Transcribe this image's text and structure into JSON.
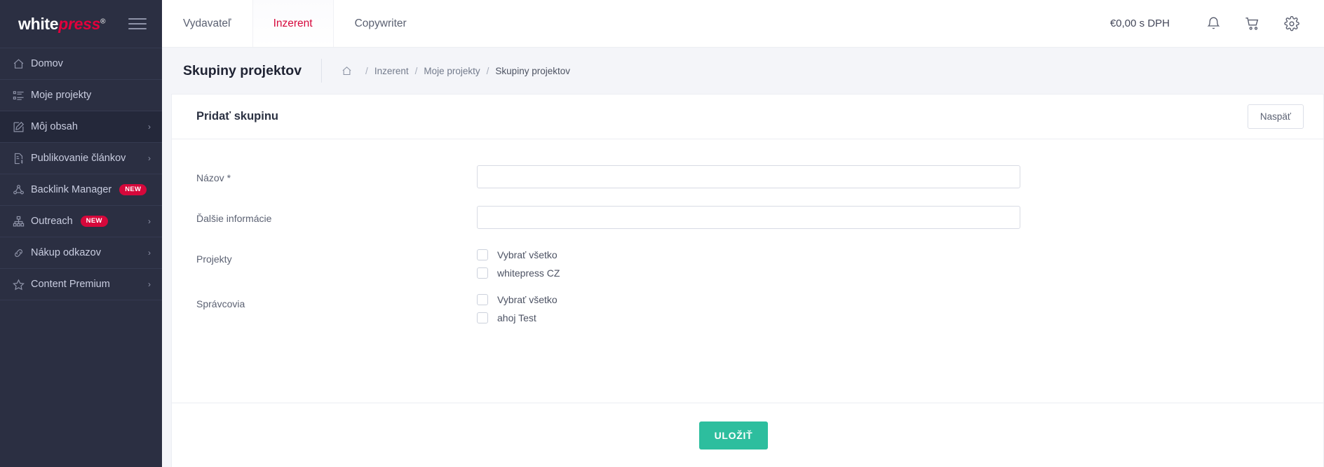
{
  "brand": {
    "logo_white": "white",
    "logo_accent": "press",
    "logo_reg": "®",
    "accent_color": "#e0003c",
    "sidebar_bg": "#2b2f42",
    "save_color": "#2dbe9e"
  },
  "sidebar": {
    "items": [
      {
        "label": "Domov",
        "icon": "home-icon",
        "badge": "",
        "chevron": false
      },
      {
        "label": "Moje projekty",
        "icon": "list-icon",
        "badge": "",
        "chevron": false
      },
      {
        "label": "Môj obsah",
        "icon": "edit-icon",
        "badge": "",
        "chevron": true
      },
      {
        "label": "Publikovanie článkov",
        "icon": "document-dollar-icon",
        "badge": "",
        "chevron": true
      },
      {
        "label": "Backlink Manager",
        "icon": "backlink-icon",
        "badge": "NEW",
        "chevron": false
      },
      {
        "label": "Outreach",
        "icon": "sitemap-icon",
        "badge": "NEW",
        "chevron": true
      },
      {
        "label": "Nákup odkazov",
        "icon": "link-icon",
        "badge": "",
        "chevron": true
      },
      {
        "label": "Content Premium",
        "icon": "star-icon",
        "badge": "",
        "chevron": true
      }
    ]
  },
  "topnav": {
    "tabs": [
      {
        "label": "Vydavateľ",
        "active": false
      },
      {
        "label": "Inzerent",
        "active": true
      },
      {
        "label": "Copywriter",
        "active": false
      }
    ],
    "price": "€0,00 s DPH",
    "icons": [
      "bell-icon",
      "cart-icon",
      "gear-icon"
    ]
  },
  "page": {
    "title": "Skupiny projektov",
    "breadcrumb": [
      {
        "label": "Inzerent",
        "current": false
      },
      {
        "label": "Moje projekty",
        "current": false
      },
      {
        "label": "Skupiny projektov",
        "current": true
      }
    ],
    "separator": "/"
  },
  "card": {
    "title": "Pridať skupinu",
    "back_label": "Naspäť",
    "save_label": "ULOŽIŤ",
    "fields": {
      "name_label": "Názov *",
      "name_value": "",
      "name_placeholder": "",
      "info_label": "Ďalšie informácie",
      "info_value": "",
      "info_placeholder": ""
    },
    "projects": {
      "label": "Projekty",
      "options": [
        {
          "label": "Vybrať všetko",
          "checked": false
        },
        {
          "label": "whitepress CZ",
          "checked": false
        }
      ]
    },
    "managers": {
      "label": "Správcovia",
      "options": [
        {
          "label": "Vybrať všetko",
          "checked": false
        },
        {
          "label": "ahoj Test",
          "checked": false
        }
      ]
    }
  }
}
